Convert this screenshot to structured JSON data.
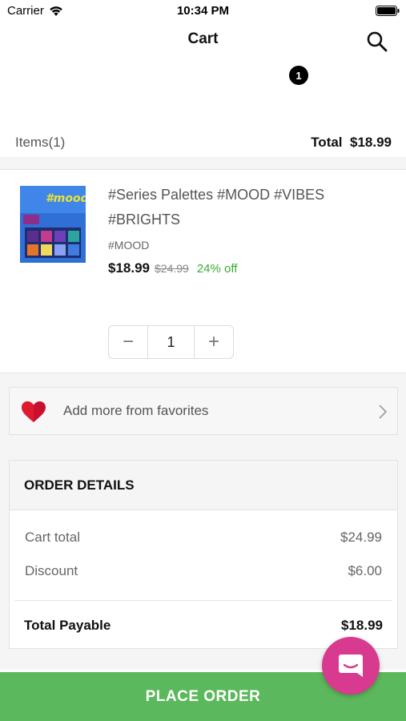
{
  "status_bar": {
    "carrier": "Carrier",
    "time": "10:34 PM"
  },
  "nav": {
    "title": "Cart",
    "cart_badge": "1"
  },
  "summary": {
    "items_label": "Items",
    "items_count": "(1)",
    "total_label": "Total",
    "total_value": "$18.99"
  },
  "product": {
    "name": "#Series Palettes #MOOD #VIBES #BRIGHTS",
    "variant": "#MOOD",
    "price": "$18.99",
    "original_price": "$24.99",
    "discount": "24% off",
    "quantity": "1",
    "minus_symbol": "−",
    "plus_symbol": "+"
  },
  "favorites": {
    "label": "Add more from favorites"
  },
  "order_details": {
    "title": "ORDER DETAILS",
    "rows": [
      {
        "label": "Cart total",
        "value": "$24.99"
      },
      {
        "label": "Discount",
        "value": "$6.00"
      }
    ],
    "total_label": "Total Payable",
    "total_value": "$18.99"
  },
  "place_order": {
    "label": "PLACE ORDER"
  },
  "colors": {
    "accent_green": "#5cb85c",
    "discount_green": "#3aaa35",
    "chat_pink": "#d83a8f",
    "heart_red": "#c8102e"
  },
  "icons": {
    "wifi": "wifi-icon",
    "battery": "battery-icon",
    "search": "search-icon",
    "heart": "heart-icon",
    "chevron": "chevron-right-icon",
    "chat": "chat-icon"
  }
}
